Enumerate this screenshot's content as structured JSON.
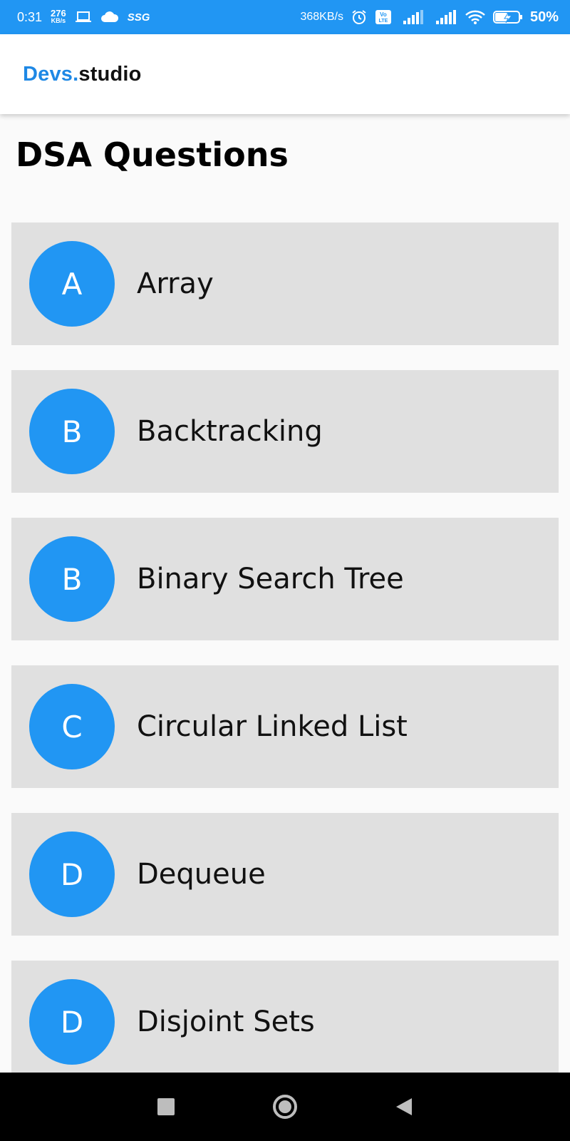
{
  "status_bar": {
    "time": "0:31",
    "net_speed_value": "276",
    "net_speed_unit": "KB/s",
    "carrier_tag": "SSG",
    "data_rate": "368KB/s",
    "volte_label": "Vo LTE",
    "battery_percent": "50%",
    "icons": [
      "laptop-icon",
      "cloud-icon",
      "alarm-icon",
      "volte-icon",
      "signal-icon",
      "signal-icon",
      "wifi-icon",
      "battery-charging-icon"
    ],
    "background_color": "#2196f3"
  },
  "app_bar": {
    "brand_accent": "Devs.",
    "brand_rest": "studio",
    "brand_accent_color": "#1e88e5"
  },
  "page": {
    "title": "DSA Questions"
  },
  "topics": [
    {
      "initial": "A",
      "label": "Array"
    },
    {
      "initial": "B",
      "label": "Backtracking"
    },
    {
      "initial": "B",
      "label": "Binary Search Tree"
    },
    {
      "initial": "C",
      "label": "Circular Linked List"
    },
    {
      "initial": "D",
      "label": "Dequeue"
    },
    {
      "initial": "D",
      "label": "Disjoint Sets"
    }
  ],
  "colors": {
    "avatar": "#2196f3",
    "card": "#e0e0e0",
    "background": "#fafafa"
  },
  "nav_bar": {
    "icons": [
      "recents-square-icon",
      "home-circle-icon",
      "back-triangle-icon"
    ]
  }
}
